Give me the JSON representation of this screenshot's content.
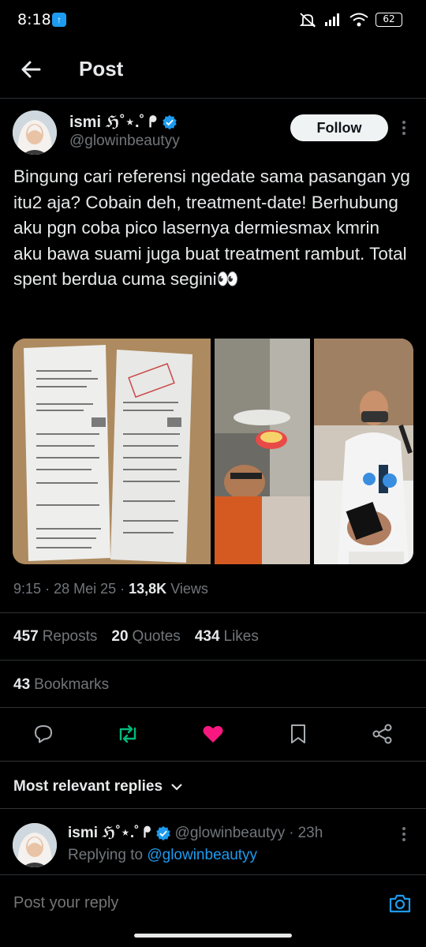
{
  "status_bar": {
    "time": "8:18",
    "battery": "62"
  },
  "header": {
    "title": "Post"
  },
  "author": {
    "name": "ismi ℌ˚⋆.˚ ᖰ",
    "handle": "@glowinbeautyy",
    "follow_label": "Follow"
  },
  "post": {
    "text": "Bingung cari referensi ngedate sama pasangan yg itu2 aja? Cobain deh, treatment-date! Berhubung aku pgn coba pico lasernya dermiesmax kmrin aku bawa suami juga buat treatment rambut. Total spent berdua cuma segini👀",
    "time": "9:15",
    "date": "28 Mei 25",
    "views_count": "13,8K",
    "views_label": "Views"
  },
  "stats": {
    "reposts_count": "457",
    "reposts_label": "Reposts",
    "quotes_count": "20",
    "quotes_label": "Quotes",
    "likes_count": "434",
    "likes_label": "Likes",
    "bookmarks_count": "43",
    "bookmarks_label": "Bookmarks"
  },
  "actions": {
    "reply_icon": "reply-icon",
    "repost_icon": "repost-icon",
    "like_icon": "heart-icon",
    "bookmark_icon": "bookmark-icon",
    "share_icon": "share-icon",
    "repost_color": "#00ba7c",
    "like_color": "#f91880"
  },
  "replies": {
    "sort_label": "Most relevant replies",
    "items": [
      {
        "name": "ismi ℌ˚⋆.˚ ᖰ",
        "handle": "@glowinbeautyy",
        "age": "23h",
        "replying_prefix": "Replying to",
        "replying_to": "@glowinbeautyy"
      }
    ]
  },
  "composer": {
    "placeholder": "Post your reply"
  },
  "colors": {
    "accent": "#1d9bf0",
    "background": "#000000",
    "text": "#e7e9ea",
    "muted": "#71767b"
  }
}
